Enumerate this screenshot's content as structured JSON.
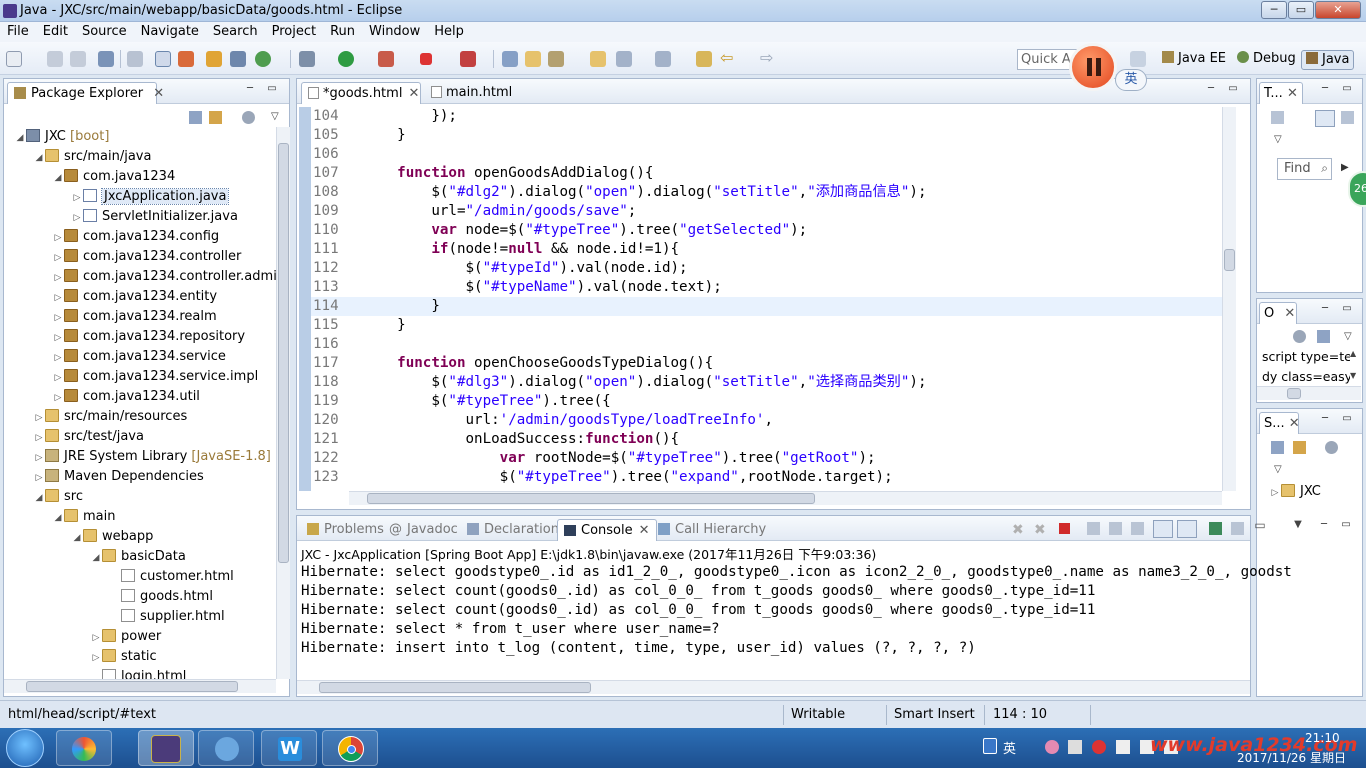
{
  "window": {
    "title": "Java - JXC/src/main/webapp/basicData/goods.html - Eclipse"
  },
  "menu": [
    "File",
    "Edit",
    "Source",
    "Navigate",
    "Search",
    "Project",
    "Run",
    "Window",
    "Help"
  ],
  "toolbar": {
    "quick_access": "Quick Access",
    "perspectives": [
      "Java EE",
      "Debug",
      "Java"
    ]
  },
  "overlay": {
    "ime_label": "英"
  },
  "package_explorer": {
    "title": "Package Explorer",
    "items": [
      {
        "label": "JXC",
        "suffix": " [boot]",
        "icon": "project",
        "indent": 0,
        "twisty": "open"
      },
      {
        "label": "src/main/java",
        "icon": "folder",
        "indent": 1,
        "twisty": "open"
      },
      {
        "label": "com.java1234",
        "icon": "package",
        "indent": 2,
        "twisty": "open"
      },
      {
        "label": "JxcApplication.java",
        "icon": "java",
        "indent": 3,
        "twisty": "closed",
        "selected": true
      },
      {
        "label": "ServletInitializer.java",
        "icon": "java",
        "indent": 3,
        "twisty": "closed"
      },
      {
        "label": "com.java1234.config",
        "icon": "package",
        "indent": 2,
        "twisty": "closed"
      },
      {
        "label": "com.java1234.controller",
        "icon": "package",
        "indent": 2,
        "twisty": "closed"
      },
      {
        "label": "com.java1234.controller.admin",
        "icon": "package",
        "indent": 2,
        "twisty": "closed"
      },
      {
        "label": "com.java1234.entity",
        "icon": "package",
        "indent": 2,
        "twisty": "closed"
      },
      {
        "label": "com.java1234.realm",
        "icon": "package",
        "indent": 2,
        "twisty": "closed"
      },
      {
        "label": "com.java1234.repository",
        "icon": "package",
        "indent": 2,
        "twisty": "closed"
      },
      {
        "label": "com.java1234.service",
        "icon": "package",
        "indent": 2,
        "twisty": "closed"
      },
      {
        "label": "com.java1234.service.impl",
        "icon": "package",
        "indent": 2,
        "twisty": "closed"
      },
      {
        "label": "com.java1234.util",
        "icon": "package",
        "indent": 2,
        "twisty": "closed"
      },
      {
        "label": "src/main/resources",
        "icon": "folder",
        "indent": 1,
        "twisty": "closed"
      },
      {
        "label": "src/test/java",
        "icon": "folder",
        "indent": 1,
        "twisty": "closed"
      },
      {
        "label": "JRE System Library",
        "suffix": " [JavaSE-1.8]",
        "icon": "library",
        "indent": 1,
        "twisty": "closed"
      },
      {
        "label": "Maven Dependencies",
        "icon": "library",
        "indent": 1,
        "twisty": "closed"
      },
      {
        "label": "src",
        "icon": "folder",
        "indent": 1,
        "twisty": "open"
      },
      {
        "label": "main",
        "icon": "folder",
        "indent": 2,
        "twisty": "open"
      },
      {
        "label": "webapp",
        "icon": "folder",
        "indent": 3,
        "twisty": "open"
      },
      {
        "label": "basicData",
        "icon": "folder",
        "indent": 4,
        "twisty": "open"
      },
      {
        "label": "customer.html",
        "icon": "html",
        "indent": 5,
        "twisty": "none"
      },
      {
        "label": "goods.html",
        "icon": "html",
        "indent": 5,
        "twisty": "none"
      },
      {
        "label": "supplier.html",
        "icon": "html",
        "indent": 5,
        "twisty": "none"
      },
      {
        "label": "power",
        "icon": "folder",
        "indent": 4,
        "twisty": "closed"
      },
      {
        "label": "static",
        "icon": "folder",
        "indent": 4,
        "twisty": "closed"
      },
      {
        "label": "login.html",
        "icon": "html",
        "indent": 4,
        "twisty": "none"
      }
    ]
  },
  "editor": {
    "tabs": [
      {
        "label": "*goods.html",
        "active": true,
        "closable": true
      },
      {
        "label": "main.html",
        "active": false,
        "closable": false
      }
    ],
    "current_line": 114,
    "lines": [
      {
        "n": 104,
        "t": [
          [
            "        });",
            ""
          ]
        ]
      },
      {
        "n": 105,
        "t": [
          [
            "    }",
            ""
          ]
        ]
      },
      {
        "n": 106,
        "t": [
          [
            "",
            ""
          ]
        ]
      },
      {
        "n": 107,
        "t": [
          [
            "    ",
            ""
          ],
          [
            "function",
            "kw"
          ],
          [
            " openGoodsAddDialog(){",
            ""
          ]
        ]
      },
      {
        "n": 108,
        "t": [
          [
            "        $(",
            ""
          ],
          [
            "\"#dlg2\"",
            "str"
          ],
          [
            ").dialog(",
            ""
          ],
          [
            "\"open\"",
            "str"
          ],
          [
            ").dialog(",
            ""
          ],
          [
            "\"setTitle\"",
            "str"
          ],
          [
            ",",
            ""
          ],
          [
            "\"添加商品信息\"",
            "str"
          ],
          [
            ");",
            ""
          ]
        ]
      },
      {
        "n": 109,
        "t": [
          [
            "        url=",
            ""
          ],
          [
            "\"/admin/goods/save\"",
            "str"
          ],
          [
            ";",
            ""
          ]
        ]
      },
      {
        "n": 110,
        "t": [
          [
            "        ",
            ""
          ],
          [
            "var",
            "kw"
          ],
          [
            " node=$(",
            ""
          ],
          [
            "\"#typeTree\"",
            "str"
          ],
          [
            ").tree(",
            ""
          ],
          [
            "\"getSelected\"",
            "str"
          ],
          [
            ");",
            ""
          ]
        ]
      },
      {
        "n": 111,
        "t": [
          [
            "        ",
            ""
          ],
          [
            "if",
            "kw"
          ],
          [
            "(node!=",
            ""
          ],
          [
            "null",
            "kw"
          ],
          [
            " && node.id!=1){",
            ""
          ]
        ]
      },
      {
        "n": 112,
        "t": [
          [
            "            $(",
            ""
          ],
          [
            "\"#typeId\"",
            "str"
          ],
          [
            ").val(node.id);",
            ""
          ]
        ]
      },
      {
        "n": 113,
        "t": [
          [
            "            $(",
            ""
          ],
          [
            "\"#typeName\"",
            "str"
          ],
          [
            ").val(node.text);",
            ""
          ]
        ]
      },
      {
        "n": 114,
        "t": [
          [
            "        }",
            ""
          ]
        ]
      },
      {
        "n": 115,
        "t": [
          [
            "    }",
            ""
          ]
        ]
      },
      {
        "n": 116,
        "t": [
          [
            "",
            ""
          ]
        ]
      },
      {
        "n": 117,
        "t": [
          [
            "    ",
            ""
          ],
          [
            "function",
            "kw"
          ],
          [
            " openChooseGoodsTypeDialog(){",
            ""
          ]
        ]
      },
      {
        "n": 118,
        "t": [
          [
            "        $(",
            ""
          ],
          [
            "\"#dlg3\"",
            "str"
          ],
          [
            ").dialog(",
            ""
          ],
          [
            "\"open\"",
            "str"
          ],
          [
            ").dialog(",
            ""
          ],
          [
            "\"setTitle\"",
            "str"
          ],
          [
            ",",
            ""
          ],
          [
            "\"选择商品类别\"",
            "str"
          ],
          [
            ");",
            ""
          ]
        ]
      },
      {
        "n": 119,
        "t": [
          [
            "        $(",
            ""
          ],
          [
            "\"#typeTree\"",
            "str"
          ],
          [
            ").tree({",
            ""
          ]
        ]
      },
      {
        "n": 120,
        "t": [
          [
            "            url:",
            ""
          ],
          [
            "'/admin/goodsType/loadTreeInfo'",
            "str"
          ],
          [
            ",",
            ""
          ]
        ]
      },
      {
        "n": 121,
        "t": [
          [
            "            onLoadSuccess:",
            ""
          ],
          [
            "function",
            "kw"
          ],
          [
            "(){",
            ""
          ]
        ]
      },
      {
        "n": 122,
        "t": [
          [
            "                ",
            ""
          ],
          [
            "var",
            "kw"
          ],
          [
            " rootNode=$(",
            ""
          ],
          [
            "\"#typeTree\"",
            "str"
          ],
          [
            ").tree(",
            ""
          ],
          [
            "\"getRoot\"",
            "str"
          ],
          [
            ");",
            ""
          ]
        ]
      },
      {
        "n": 123,
        "t": [
          [
            "                $(",
            ""
          ],
          [
            "\"#typeTree\"",
            "str"
          ],
          [
            ").tree(",
            ""
          ],
          [
            "\"expand\"",
            "str"
          ],
          [
            ",rootNode.target);",
            ""
          ]
        ]
      }
    ]
  },
  "right_views": {
    "task_list": {
      "title": "T...",
      "find_placeholder": "Find"
    },
    "outline": {
      "title": "O",
      "items": [
        "script type=te",
        "dy class=easyu"
      ]
    },
    "servers": {
      "title": "S...",
      "items": [
        "JXC"
      ]
    },
    "badge": "26"
  },
  "console": {
    "tabs": [
      {
        "label": "Problems"
      },
      {
        "label": "Javadoc"
      },
      {
        "label": "Declaration"
      },
      {
        "label": "Console",
        "active": true
      },
      {
        "label": "Call Hierarchy"
      }
    ],
    "header": "JXC - JxcApplication [Spring Boot App] E:\\jdk1.8\\bin\\javaw.exe (2017年11月26日 下午9:03:36)",
    "lines": [
      "Hibernate: select goodstype0_.id as id1_2_0_, goodstype0_.icon as icon2_2_0_, goodstype0_.name as name3_2_0_, goodst",
      "Hibernate: select count(goods0_.id) as col_0_0_ from t_goods goods0_ where goods0_.type_id=11",
      "Hibernate: select count(goods0_.id) as col_0_0_ from t_goods goods0_ where goods0_.type_id=11",
      "Hibernate: select * from t_user where user_name=?",
      "Hibernate: insert into t_log (content, time, type, user_id) values (?, ?, ?, ?)"
    ]
  },
  "status": {
    "path": "html/head/script/#text",
    "writable": "Writable",
    "insert_mode": "Smart Insert",
    "position": "114 : 10"
  },
  "taskbar": {
    "tray_lang": "英",
    "time": "21:10",
    "date": "2017/11/26 星期日",
    "watermark": "www.java1234.com"
  },
  "colors": {
    "keyword": "#7f0055",
    "string": "#2a00ff",
    "current_line": "#e8f2fe",
    "taskbar": "#2c6fb6"
  }
}
